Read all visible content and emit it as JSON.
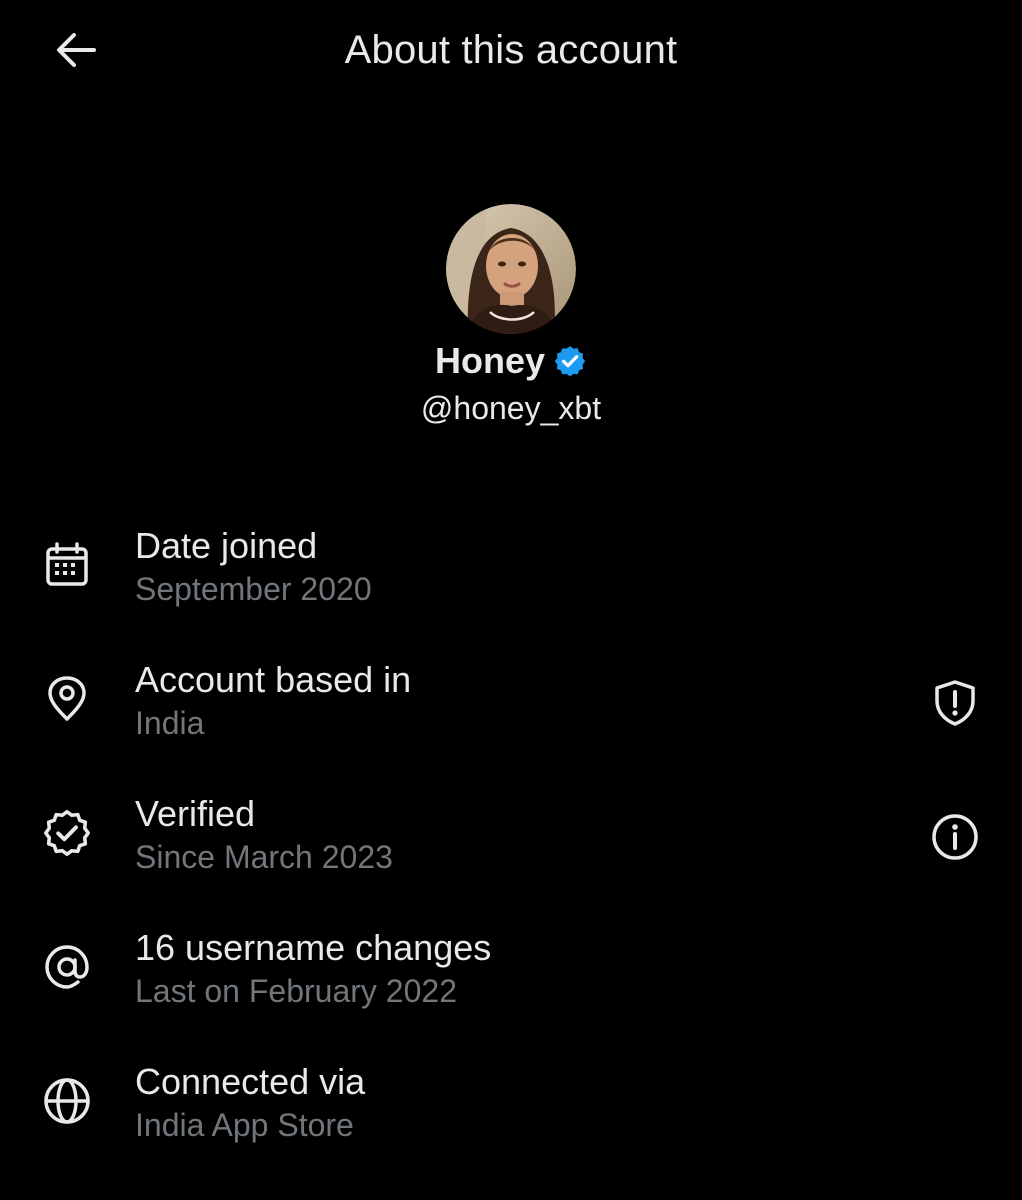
{
  "header": {
    "title": "About this account",
    "back_icon": "arrow-left-icon"
  },
  "profile": {
    "display_name": "Honey",
    "handle": "@honey_xbt",
    "verified_badge_icon": "verified-badge-icon",
    "verified_color": "#1d9bf0"
  },
  "rows": [
    {
      "icon": "calendar-icon",
      "label": "Date joined",
      "value": "September 2020"
    },
    {
      "icon": "location-pin-icon",
      "label": "Account based in",
      "value": "India",
      "action_icon": "shield-alert-icon"
    },
    {
      "icon": "verified-check-icon",
      "label": "Verified",
      "value": "Since March 2023",
      "action_icon": "info-icon"
    },
    {
      "icon": "at-sign-icon",
      "label": "16 username changes",
      "value": "Last on February 2022"
    },
    {
      "icon": "globe-icon",
      "label": "Connected via",
      "value": "India App Store"
    }
  ],
  "colors": {
    "background": "#000000",
    "primary_text": "#e7e9ea",
    "secondary_text": "#71767b",
    "accent": "#1d9bf0"
  }
}
